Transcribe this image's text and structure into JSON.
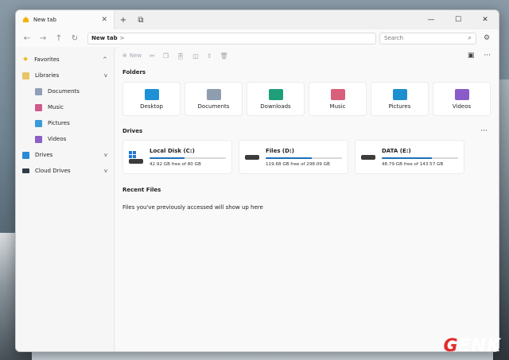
{
  "tab": {
    "title": "New tab",
    "close": "✕"
  },
  "titlebar": {
    "new_tab": "+",
    "duplicate": "⧉",
    "minimize": "—",
    "maximize": "☐",
    "close": "✕"
  },
  "address": {
    "path": "New tab",
    "separator": ">",
    "search_placeholder": "Search"
  },
  "sidebar": {
    "items": [
      {
        "label": "Favorites",
        "color": "#e6b800",
        "chev": "^"
      },
      {
        "label": "Libraries",
        "color": "#e9c46a",
        "chev": "v"
      },
      {
        "label": "Documents",
        "color": "#8ea0b5"
      },
      {
        "label": "Music",
        "color": "#d05a8a"
      },
      {
        "label": "Pictures",
        "color": "#3a9ad9"
      },
      {
        "label": "Videos",
        "color": "#8b5fc7"
      },
      {
        "label": "Drives",
        "color": "#2b8ad6",
        "chev": "v"
      },
      {
        "label": "Cloud Drives",
        "color": "#2f3b48",
        "chev": "v"
      }
    ]
  },
  "toolbar": {
    "new_label": "New"
  },
  "sections": {
    "folders": "Folders",
    "drives": "Drives",
    "recent": "Recent Files",
    "more": "···"
  },
  "folders": [
    {
      "label": "Desktop",
      "color": "#1e90d6"
    },
    {
      "label": "Documents",
      "color": "#8e9db0"
    },
    {
      "label": "Downloads",
      "color": "#1f9e7a"
    },
    {
      "label": "Music",
      "color": "#d9607a"
    },
    {
      "label": "Pictures",
      "color": "#1c8fd1"
    },
    {
      "label": "Videos",
      "color": "#8a5cc9"
    }
  ],
  "drives": [
    {
      "name": "Local Disk (C:)",
      "free": "42.92 GB free of 80 GB",
      "used_fraction": 0.46
    },
    {
      "name": "Files (D:)",
      "free": "119.68 GB free of 298.09 GB",
      "used_fraction": 0.6
    },
    {
      "name": "DATA (E:)",
      "free": "48.79 GB free of 143.57 GB",
      "used_fraction": 0.66
    }
  ],
  "recent": {
    "empty_message": "Files you've previously accessed will show up here"
  },
  "watermark": {
    "g": "G",
    "rest": "ENK"
  }
}
